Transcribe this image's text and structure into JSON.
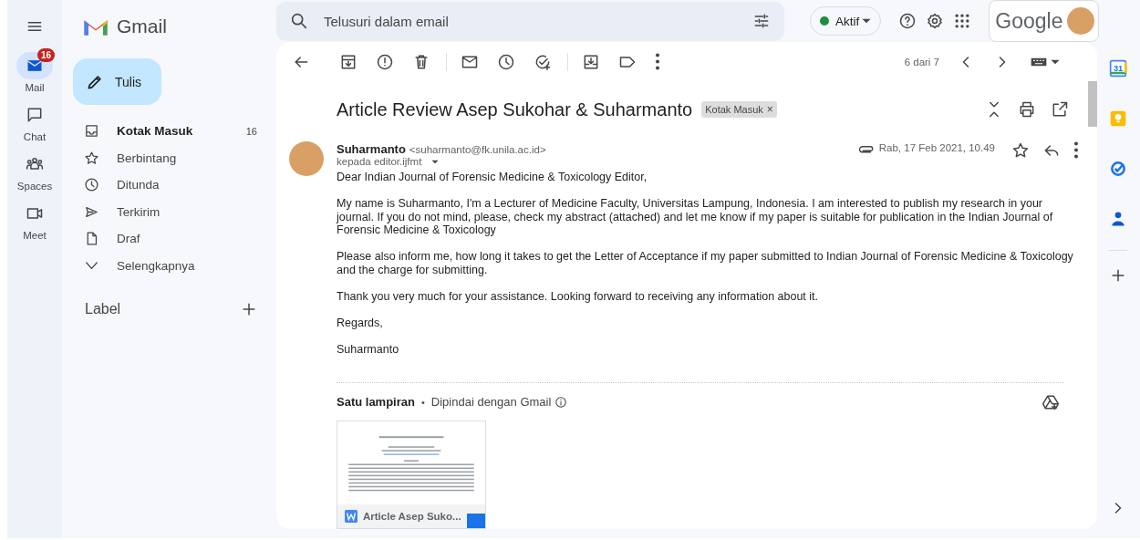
{
  "app": {
    "name": "Gmail"
  },
  "search": {
    "placeholder": "Telusuri dalam email"
  },
  "status": {
    "label": "Aktif"
  },
  "account": {
    "brand": "Google"
  },
  "rail": [
    {
      "kind": "mail",
      "label": "Mail",
      "badge": "16",
      "selected": true
    },
    {
      "kind": "chat",
      "label": "Chat",
      "selected": false
    },
    {
      "kind": "spaces",
      "label": "Spaces",
      "selected": false
    },
    {
      "kind": "meet",
      "label": "Meet",
      "selected": false
    }
  ],
  "compose": {
    "label": "Tulis"
  },
  "folders": [
    {
      "kind": "inbox",
      "label": "Kotak Masuk",
      "count": "16",
      "unread": true
    },
    {
      "kind": "star",
      "label": "Berbintang",
      "unread": false
    },
    {
      "kind": "clock",
      "label": "Ditunda",
      "unread": false
    },
    {
      "kind": "send",
      "label": "Terkirim",
      "unread": false
    },
    {
      "kind": "draft",
      "label": "Draf",
      "unread": false
    },
    {
      "kind": "more",
      "label": "Selengkapnya",
      "unread": false
    }
  ],
  "labels_header": {
    "title": "Label"
  },
  "toolbar": {
    "position": "6 dari 7"
  },
  "email": {
    "subject": "Article Review Asep Sukohar & Suharmanto",
    "tag": "Kotak Masuk",
    "tag_close": "×",
    "sender_name": "Suharmanto",
    "sender_email": "<suharmanto@fk.unila.ac.id>",
    "recipient": "kepada editor.ijfmt",
    "date": "Rab, 17 Feb 2021, 10.49",
    "starred": false,
    "paragraphs": [
      "Dear Indian Journal of Forensic Medicine & Toxicology Editor,",
      "My name is Suharmanto, I'm a Lecturer of Medicine Faculty, Universitas Lampung, Indonesia. I am interested to publish my research in your journal. If you do not mind, please, check my abstract (attached) and let me know if my paper is suitable for publication in the Indian Journal of Forensic Medicine & Toxicology",
      "Please also inform me, how long it takes to get the Letter of Acceptance if my paper submitted to Indian Journal of Forensic Medicine & Toxicology and the charge for submitting.",
      "Thank you very much for your assistance. Looking forward to receiving any information about it.",
      "Regards,",
      "Suharmanto"
    ]
  },
  "attachments": {
    "title": "Satu lampiran",
    "separator": "•",
    "scan_note": "Dipindai dengan Gmail",
    "files": [
      {
        "name": "Article Asep Suko..."
      }
    ]
  },
  "side_panel": {
    "calendar_day": "31"
  }
}
